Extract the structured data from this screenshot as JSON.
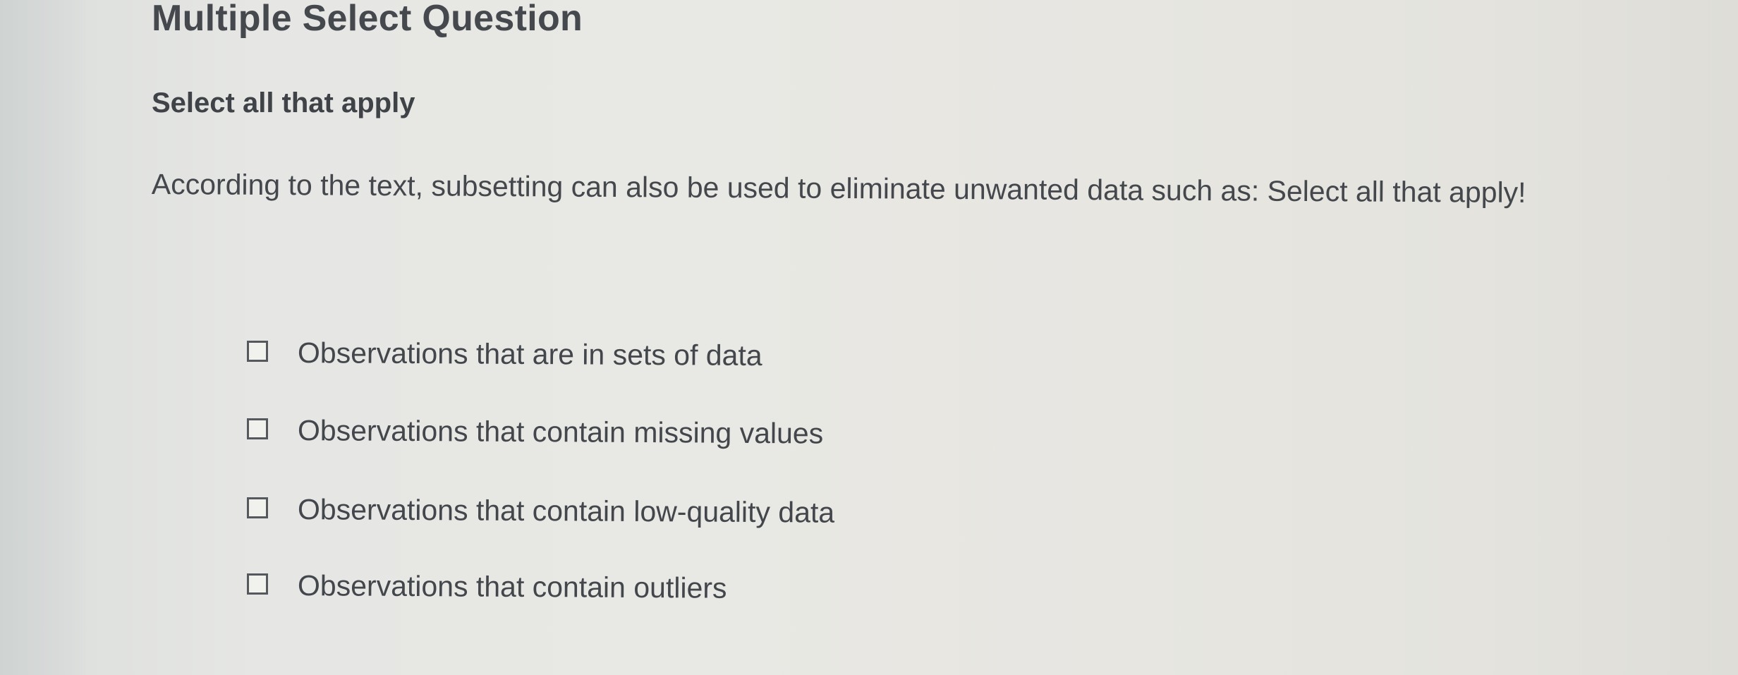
{
  "question": {
    "type_label": "Multiple Select Question",
    "instruction": "Select all that apply",
    "prompt": "According to the text, subsetting can also be used to eliminate unwanted data such as: Select all that apply!"
  },
  "options": [
    {
      "label": "Observations that are in sets of data",
      "checked": false
    },
    {
      "label": "Observations that contain missing values",
      "checked": false
    },
    {
      "label": "Observations that contain low-quality data",
      "checked": false
    },
    {
      "label": "Observations that contain outliers",
      "checked": false
    }
  ],
  "colors": {
    "background": "#e6e7e4",
    "text": "#43474c",
    "checkbox_border": "#55595e"
  }
}
